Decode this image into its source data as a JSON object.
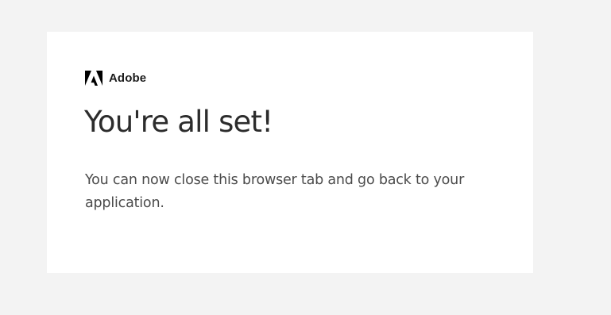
{
  "brand": {
    "name": "Adobe",
    "logo_icon": "adobe-logo-icon",
    "logo_color": "#000000"
  },
  "main": {
    "title": "You're all set!",
    "message": "You can now close this browser tab and go back to your application."
  },
  "colors": {
    "page_background": "#f3f3f3",
    "card_background": "#ffffff",
    "title_text": "#2c2c2c",
    "body_text": "#4b4b4b"
  }
}
